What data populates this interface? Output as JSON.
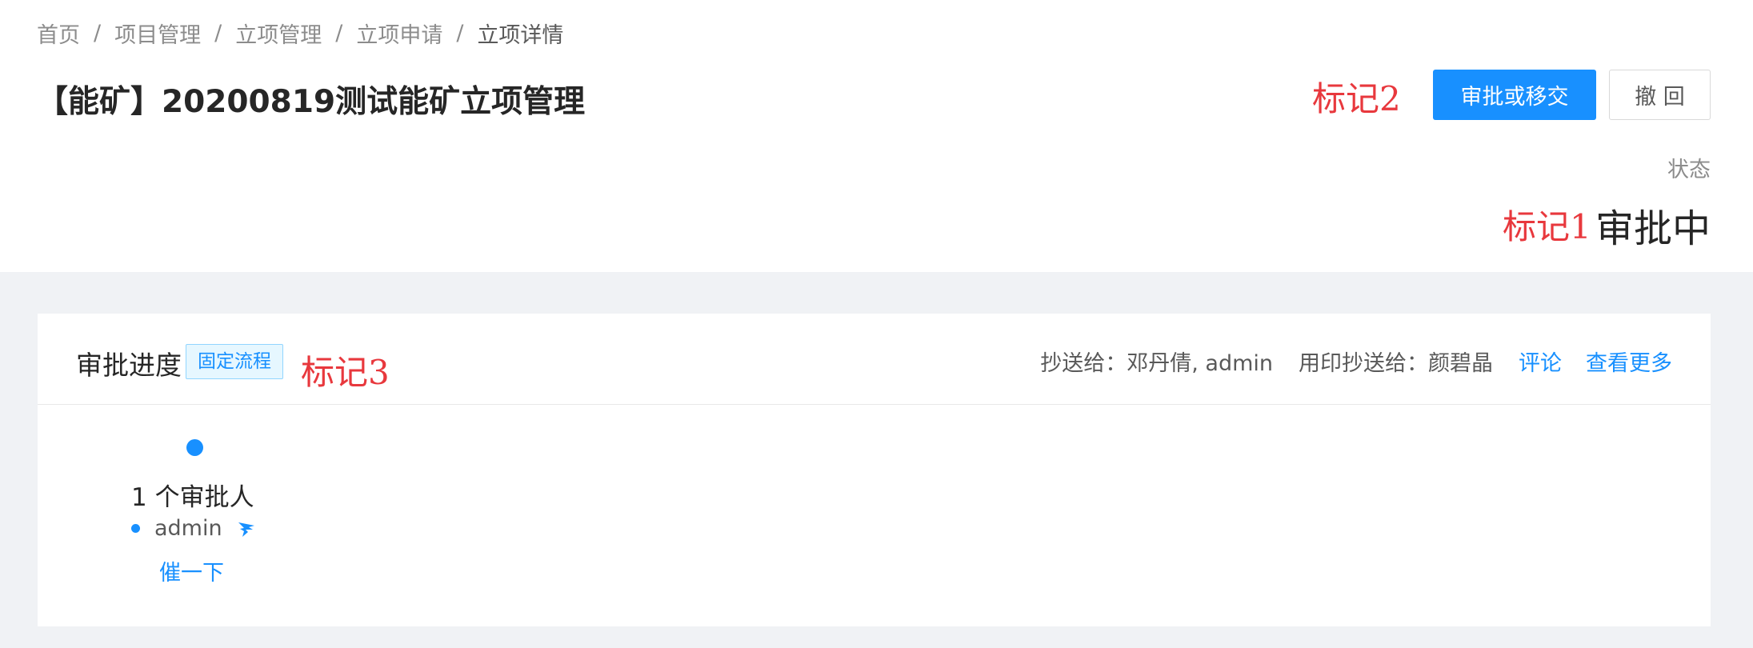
{
  "breadcrumb": {
    "items": [
      "首页",
      "项目管理",
      "立项管理",
      "立项申请"
    ],
    "current": "立项详情",
    "separator": "/"
  },
  "page": {
    "title": "【能矿】20200819测试能矿立项管理"
  },
  "actions": {
    "approve_transfer_label": "审批或移交",
    "withdraw_label": "撤 回"
  },
  "status": {
    "label": "状态",
    "value": "审批中"
  },
  "markers": {
    "marker1": "标记1",
    "marker2": "标记2",
    "marker3": "标记3"
  },
  "approval": {
    "title": "审批进度",
    "flow_tag": "固定流程",
    "cc": "抄送给：邓丹倩, admin",
    "seal_cc": "用印抄送给：颜碧晶",
    "comment_link": "评论",
    "more_link": "查看更多",
    "approver_count": "1 个审批人",
    "approver_name": "admin",
    "approver_icon": "dingtalk-icon",
    "urge_link": "催一下"
  },
  "colors": {
    "primary": "#1890ff",
    "marker": "#e8383d",
    "background": "#f0f2f5"
  }
}
